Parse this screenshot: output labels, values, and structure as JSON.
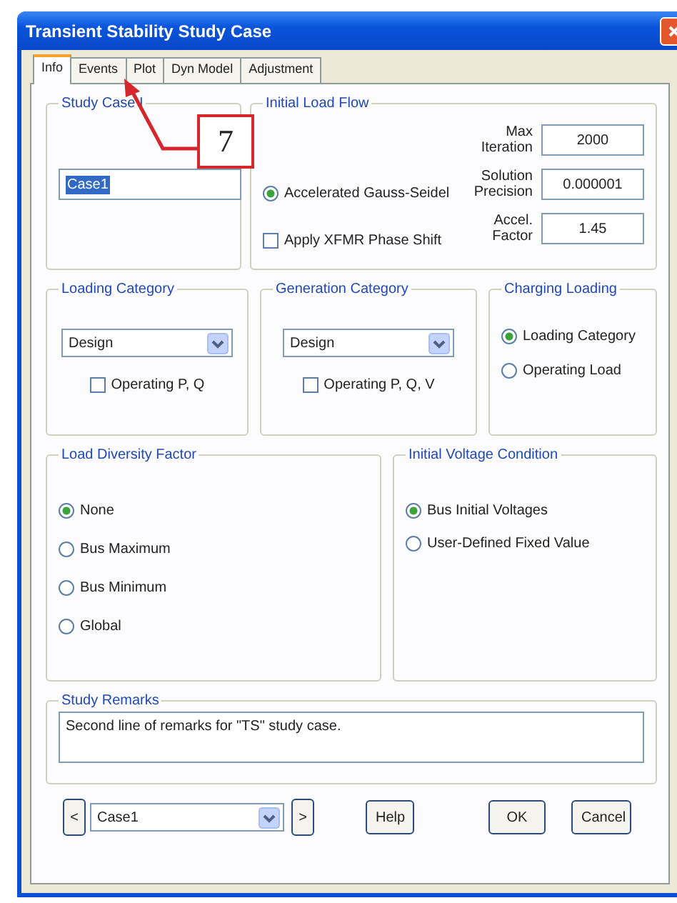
{
  "window": {
    "title": "Transient Stability Study Case"
  },
  "tabs": [
    {
      "label": "Info",
      "selected": true
    },
    {
      "label": "Events",
      "selected": false
    },
    {
      "label": "Plot",
      "selected": false
    },
    {
      "label": "Dyn Model",
      "selected": false
    },
    {
      "label": "Adjustment",
      "selected": false
    }
  ],
  "study_case_id": {
    "label": "Study Case I",
    "value": "Case1"
  },
  "initial_load_flow": {
    "label": "Initial Load Flow",
    "method": {
      "label": "Accelerated Gauss-Seidel",
      "selected": true
    },
    "phase_shift": {
      "label": "Apply XFMR Phase Shift",
      "checked": false
    },
    "fields": [
      {
        "label": "Max Iteration",
        "value": "2000"
      },
      {
        "label": "Solution Precision",
        "value": "0.000001"
      },
      {
        "label": "Accel. Factor",
        "value": "1.45"
      }
    ]
  },
  "loading_category": {
    "label": "Loading Category",
    "value": "Design",
    "option": {
      "label": "Operating P, Q",
      "checked": false
    }
  },
  "generation_category": {
    "label": "Generation Category",
    "value": "Design",
    "option": {
      "label": "Operating P, Q, V",
      "checked": false
    }
  },
  "charging_loading": {
    "label": "Charging Loading",
    "options": [
      {
        "label": "Loading Category",
        "selected": true
      },
      {
        "label": "Operating Load",
        "selected": false
      }
    ]
  },
  "load_diversity_factor": {
    "label": "Load Diversity Factor",
    "options": [
      {
        "label": "None",
        "selected": true
      },
      {
        "label": "Bus Maximum",
        "selected": false
      },
      {
        "label": "Bus Minimum",
        "selected": false
      },
      {
        "label": "Global",
        "selected": false
      }
    ]
  },
  "initial_voltage_condition": {
    "label": "Initial Voltage Condition",
    "options": [
      {
        "label": "Bus Initial Voltages",
        "selected": true
      },
      {
        "label": "User-Defined Fixed Value",
        "selected": false
      }
    ]
  },
  "study_remarks": {
    "label": "Study Remarks",
    "value": "Second line of remarks for \"TS\" study case."
  },
  "footer": {
    "previous": "<",
    "case": "Case1",
    "next": ">",
    "buttons": [
      "Help",
      "OK",
      "Cancel"
    ]
  },
  "annotation": {
    "label": "7"
  }
}
